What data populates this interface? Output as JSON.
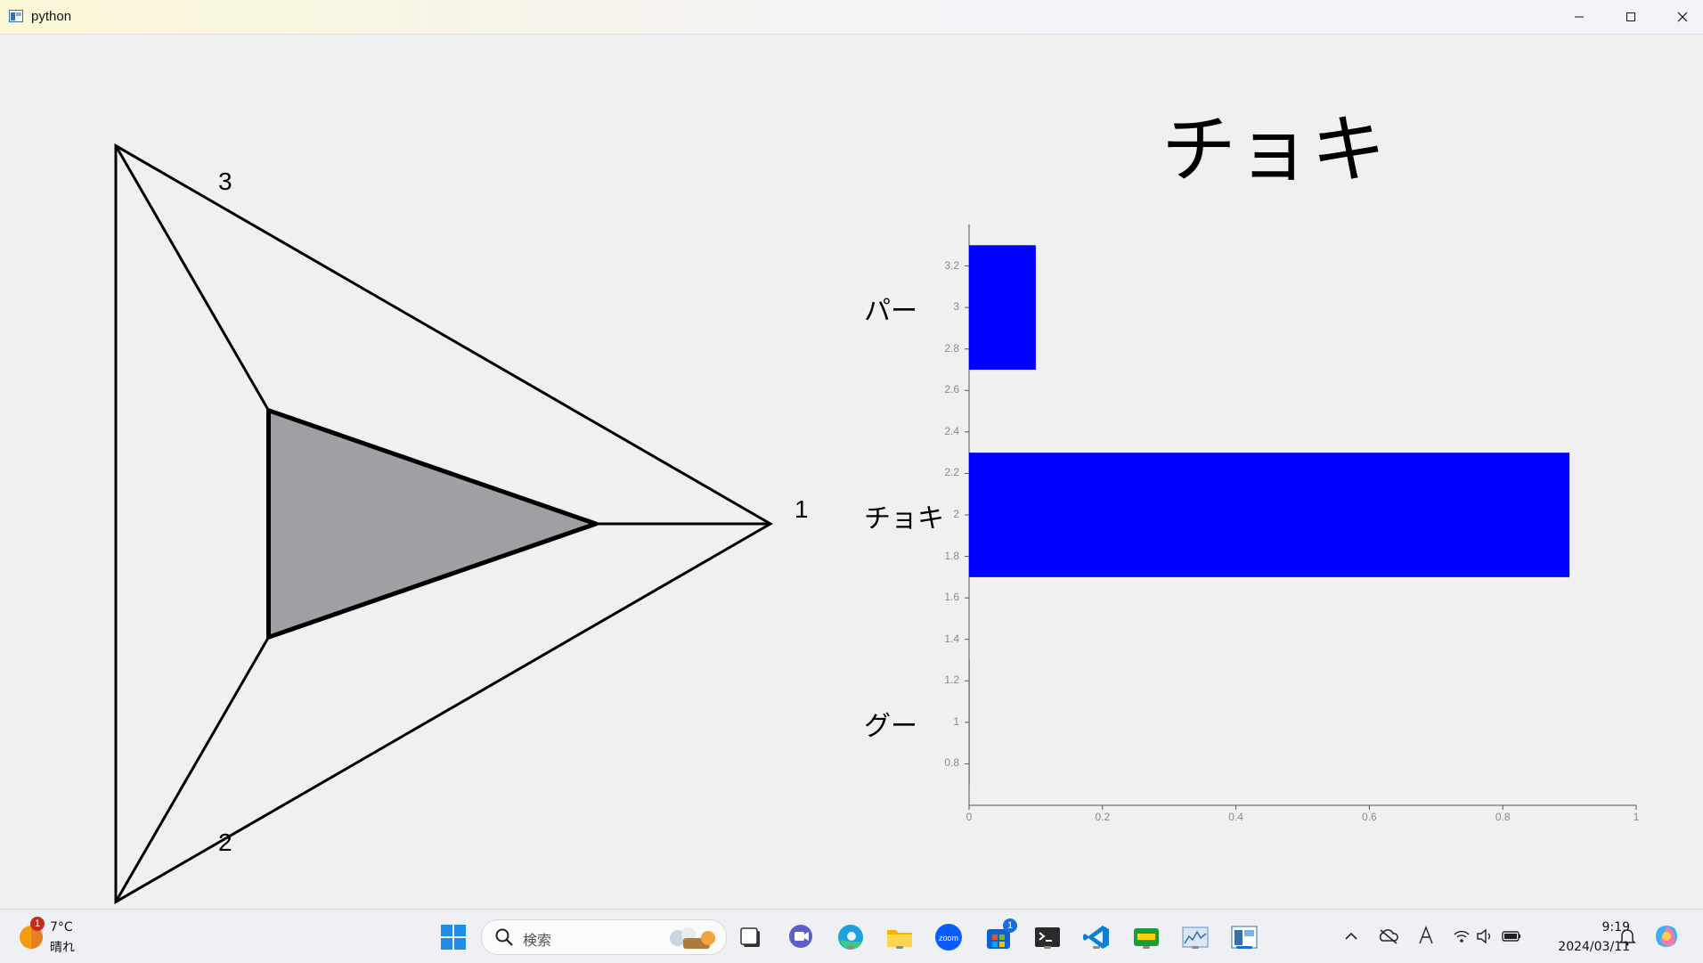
{
  "window": {
    "title": "python"
  },
  "radar": {
    "axis_labels": [
      "1",
      "2",
      "3"
    ],
    "values": [
      0.6,
      0.3,
      0.3
    ],
    "fill_color": "#a0a0a4"
  },
  "chart_data": {
    "type": "bar",
    "orientation": "horizontal",
    "title": "チョキ",
    "categories": [
      "グー",
      "チョキ",
      "パー"
    ],
    "y_positions": [
      1,
      2,
      3
    ],
    "values": [
      0.0,
      0.9,
      0.1
    ],
    "bar_color": "#0000ff",
    "xlim": [
      0,
      1
    ],
    "ylim": [
      0.6,
      3.4
    ],
    "xticks": [
      "0",
      "0.2",
      "0.4",
      "0.6",
      "0.8",
      "1"
    ],
    "yticks": [
      "0.8",
      "1",
      "1.2",
      "1.4",
      "1.6",
      "1.8",
      "2",
      "2.2",
      "2.4",
      "2.6",
      "2.8",
      "3",
      "3.2"
    ],
    "grid": false
  },
  "taskbar": {
    "weather": {
      "temp": "7°C",
      "condition": "晴れ",
      "badge": "1"
    },
    "search": {
      "placeholder": "検索"
    },
    "apps": [
      "start-icon",
      "task-view-icon",
      "teams-icon",
      "edge-icon",
      "file-explorer-icon",
      "zoom-icon",
      "store-icon",
      "terminal-icon",
      "vscode-icon",
      "app-green-icon",
      "resource-monitor-icon",
      "python-window-icon"
    ],
    "store_badge": "1",
    "clock": {
      "time": "9:19",
      "date": "2024/03/11"
    }
  }
}
